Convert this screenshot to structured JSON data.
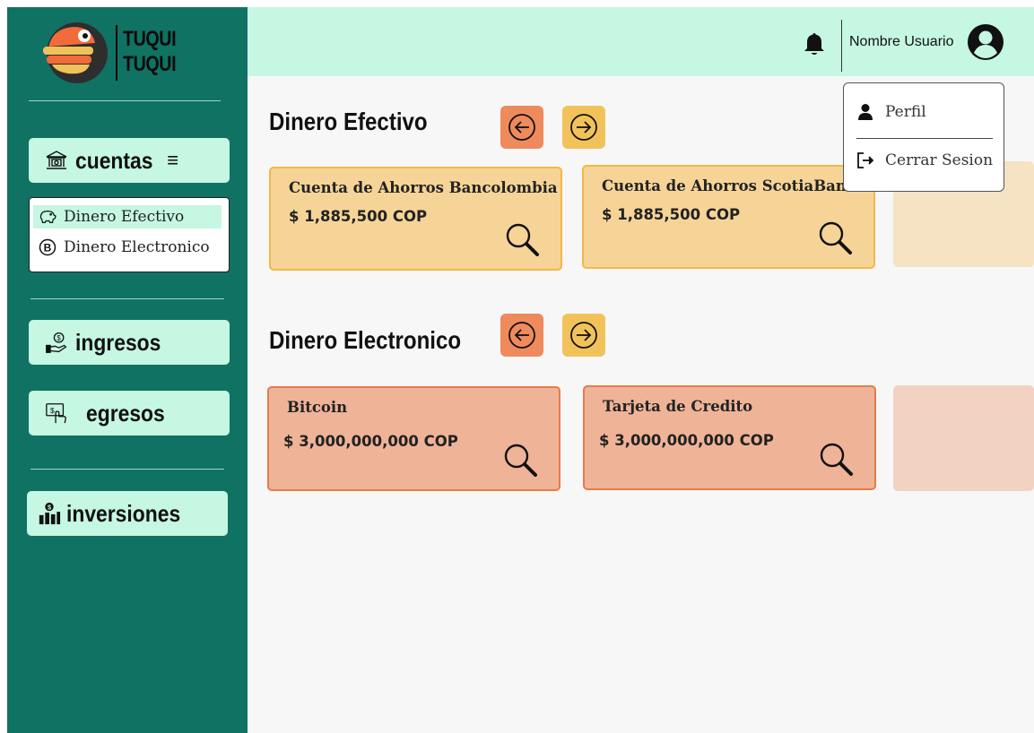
{
  "brand": {
    "line1": "TUQUI",
    "line2": "TUQUI"
  },
  "sidebar": {
    "cuentas": {
      "label": "cuentas",
      "menu_glyph": "≡",
      "icon": "bank-icon"
    },
    "submenu": [
      {
        "label": "Dinero Efectivo",
        "icon": "piggy-bank-icon",
        "active": true
      },
      {
        "label": "Dinero Electronico",
        "icon": "bitcoin-icon",
        "active": false
      }
    ],
    "ingresos": {
      "label": "ingresos",
      "icon": "hand-coin-icon"
    },
    "egresos": {
      "label": "egresos",
      "icon": "pay-hand-icon"
    },
    "inversiones": {
      "label": "inversiones",
      "icon": "investment-chart-icon"
    }
  },
  "header": {
    "username": "Nombre Usuario",
    "notification_icon": "bell-icon",
    "avatar_icon": "user-circle-icon"
  },
  "user_menu": {
    "items": [
      {
        "label": "Perfil",
        "icon": "person-icon"
      },
      {
        "label": "Cerrar Sesion",
        "icon": "logout-icon"
      }
    ]
  },
  "sections": [
    {
      "title": "Dinero Efectivo",
      "cards": [
        {
          "title": "Cuenta de Ahorros Bancolombia",
          "amount": "$ 1,885,500 COP"
        },
        {
          "title": "Cuenta de Ahorros ScotiaBank",
          "amount": "$ 1,885,500 COP"
        }
      ]
    },
    {
      "title": "Dinero Electronico",
      "cards": [
        {
          "title": "Bitcoin",
          "amount": "$ 3,000,000,000 COP"
        },
        {
          "title": "Tarjeta de Credito",
          "amount": "$ 3,000,000,000 COP"
        }
      ]
    }
  ],
  "colors": {
    "sidebar": "#0f7263",
    "mint": "#c5f7e2",
    "cash_card": "#f6d497",
    "cash_border": "#f3b845",
    "elec_card": "#efb398",
    "elec_border": "#e77b48",
    "prev_button": "#ee8a5c",
    "next_button": "#f2c25a"
  }
}
